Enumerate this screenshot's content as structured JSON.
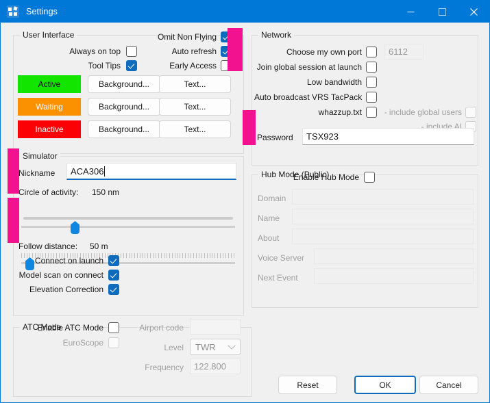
{
  "window": {
    "title": "Settings",
    "icon": "settings-app-icon",
    "minimize": "minimize-icon",
    "maximize": "maximize-icon",
    "close": "close-icon"
  },
  "user_interface": {
    "legend": "User Interface",
    "always_on_top": "Always on top",
    "tool_tips": "Tool Tips",
    "omit_non_flying": "Omit Non Flying",
    "auto_refresh": "Auto refresh",
    "early_access": "Early Access",
    "rows": [
      {
        "state": "Active",
        "bg": "#12e500",
        "fg": "#0d0d0d",
        "background_btn": "Background...",
        "text_btn": "Text..."
      },
      {
        "state": "Waiting",
        "bg": "#fb9000",
        "fg": "#ffffff",
        "background_btn": "Background...",
        "text_btn": "Text..."
      },
      {
        "state": "Inactive",
        "bg": "#fb0005",
        "fg": "#ffffff",
        "background_btn": "Background...",
        "text_btn": "Text..."
      }
    ]
  },
  "simulator": {
    "legend": "Simulator",
    "nickname_label": "Nickname",
    "nickname_value": "ACA306",
    "circle_label": "Circle of activity:",
    "circle_value": "150 nm",
    "follow_label": "Follow distance:",
    "follow_value": "50 m",
    "connect_on_launch": "Connect on launch",
    "model_scan_on_connect": "Model scan on connect",
    "elevation_correction": "Elevation Correction"
  },
  "atc_mode": {
    "legend": "ATC Mode",
    "enable_label": "Enable ATC Mode",
    "euroscope_label": "EuroScope",
    "airport_code_label": "Airport code",
    "airport_code_value": "",
    "level_label": "Level",
    "level_value": "TWR",
    "frequency_label": "Frequency",
    "frequency_value": "122.800"
  },
  "network": {
    "legend": "Network",
    "choose_port_label": "Choose my own port",
    "port_value": "6112",
    "join_global_label": "Join global session at launch",
    "low_bandwidth_label": "Low bandwidth",
    "auto_broadcast_label": "Auto broadcast VRS TacPack",
    "whazzup_label": "whazzup.txt",
    "include_global_users_label": "- include global users",
    "include_ai_label": "- include AI",
    "password_label": "Password",
    "password_value": "TSX923"
  },
  "hub_mode": {
    "legend": "Hub Mode (Public)",
    "enable_label": "Enable Hub Mode",
    "domain_label": "Domain",
    "domain_value": "",
    "name_label": "Name",
    "name_value": "",
    "about_label": "About",
    "about_value": "",
    "voice_server_label": "Voice Server",
    "voice_server_value": "",
    "next_event_label": "Next Event",
    "next_event_value": ""
  },
  "footer": {
    "reset": "Reset",
    "ok": "OK",
    "cancel": "Cancel"
  },
  "colors": {
    "titlebar": "#0078d7",
    "accent": "#0f6cbd",
    "annotation": "#f2118f",
    "window_bg": "#f0f0f0"
  }
}
